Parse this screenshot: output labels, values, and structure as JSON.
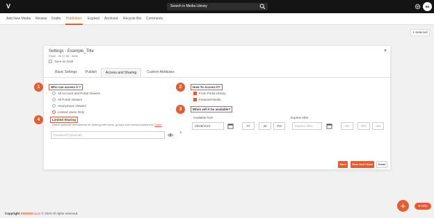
{
  "app": {
    "logo": "V"
  },
  "header": {
    "search_placeholder": "Search in Media Library",
    "avatar_initials": "BB"
  },
  "nav": {
    "items": [
      {
        "label": "Add New Media"
      },
      {
        "label": "Review"
      },
      {
        "label": "Drafts"
      },
      {
        "label": "Published"
      },
      {
        "label": "Expired"
      },
      {
        "label": "Archived"
      },
      {
        "label": "Recycle Bin"
      },
      {
        "label": "Comments"
      }
    ],
    "active": "Published"
  },
  "selection": {
    "label": "1 Selected"
  },
  "modal": {
    "title": "Settings - Example_Title",
    "meta": {
      "size": "Panel",
      "duration": "00:07:38",
      "count": "6066"
    },
    "save_as_draft": "Save as Draft",
    "tabs": [
      {
        "label": "Basic Settings"
      },
      {
        "label": "Publish"
      },
      {
        "label": "Access and Sharing"
      },
      {
        "label": "Custom Attributes"
      }
    ],
    "active_tab": "Access and Sharing",
    "section1": {
      "badge": "1",
      "heading": "Who can access it ?",
      "options": [
        {
          "label": "All Account and Portal Viewers"
        },
        {
          "label": "All Portal Viewers"
        },
        {
          "label": "Anonymous Viewers"
        },
        {
          "label": "Limited Users Only"
        }
      ],
      "selected": "Limited Users Only"
    },
    "section2": {
      "badge": "2",
      "heading": "How To Access it?",
      "options": [
        {
          "label": "From Portal Library"
        },
        {
          "label": "Featured Media"
        }
      ]
    },
    "section3": {
      "badge": "3",
      "heading": "When will it be available?",
      "available_from": {
        "label": "Available from",
        "date": "09/28/2023",
        "hour": "07",
        "minute": "38",
        "ampm": "PM"
      },
      "expires_after": {
        "label": "Expires After",
        "date_placeholder": "Expires After",
        "hour_placeholder": "HH",
        "minute_placeholder": "MM",
        "ampm_placeholder": "AM"
      }
    },
    "section4": {
      "badge": "4",
      "heading": "Limited Sharing",
      "description": "Define granular permissions for sharing with users, groups and external audiences",
      "share_link": "Share",
      "password_placeholder": "Password (Optional)"
    },
    "buttons": {
      "save": "Save",
      "save_close": "Save And Close",
      "close": "Close"
    }
  },
  "footer": {
    "prefix": "Copyright",
    "brand": "VIDIZMO LLC",
    "rest": "© 2023 All rights reserved."
  },
  "help": {
    "label": "Help"
  },
  "colors": {
    "accent": "#e85b2f",
    "topbar": "#141414"
  }
}
